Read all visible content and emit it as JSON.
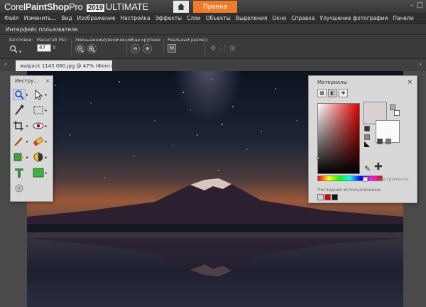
{
  "titlebar": {
    "brand_corel": "Corel",
    "brand_app": "PaintShop",
    "brand_pro": "Pro",
    "version": "2019",
    "edition": "ULTIMATE",
    "home_icon": "home-icon",
    "edit_tab": "Правка"
  },
  "menu": [
    "Файл",
    "Изменить...",
    "Вид",
    "Изображение",
    "Настройка",
    "Эффекты",
    "Слои",
    "Объекты",
    "Выделения",
    "Окно",
    "Справка",
    "Улучшение фотографии",
    "Панели"
  ],
  "workspace_label": "Интерфейс пользователя",
  "options": {
    "presets_label": "Заготовки:",
    "zoom_label": "Масштаб (%):",
    "zoom_value": "47",
    "zoom_inout_label": "Уменьшение/увеличение:",
    "more_zoom_label": "Еще крупнее:",
    "actual_size_label": "Реальный размер:"
  },
  "document": {
    "tab_label": "walpack 1143 060.jpg @  47% (Фон)",
    "close": "×"
  },
  "tools_palette": {
    "title": "Инстру...",
    "close": "×",
    "tools": [
      "zoom-tool",
      "pick-tool",
      "dropper-tool",
      "selection-tool",
      "crop-tool",
      "redeye-tool",
      "clone-brush-tool",
      "eraser-tool",
      "fill-tool",
      "dodge-tool",
      "text-tool",
      "rectangle-tool",
      "script-tool"
    ]
  },
  "materials_palette": {
    "title": "Материалы",
    "close": "×",
    "foreground_color": "#d9d0d0",
    "background_color": "#fafafa",
    "all_tools_label": "Все инструменты",
    "recent_label": "Последние использованные",
    "recent_colors": [
      "#d0d0d0",
      "#e00000",
      "#111111"
    ]
  },
  "colors": {
    "accent_orange": "#ef7b2b"
  }
}
